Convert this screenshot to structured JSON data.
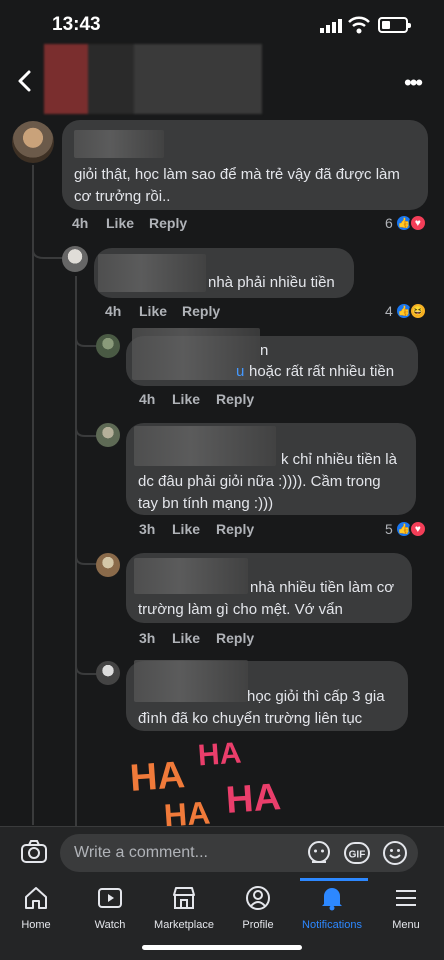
{
  "status_bar": {
    "time": "13:43"
  },
  "header": {
    "more_label": "•••"
  },
  "comments": [
    {
      "text": "giỏi thật, học làm sao để mà trẻ vậy đã được làm cơ trưởng rồi..",
      "time": "4h",
      "like": "Like",
      "reply": "Reply",
      "reaction_count": "6",
      "reactions": [
        "like",
        "love"
      ]
    },
    {
      "text": "nhà phải nhiều tiền",
      "time": "4h",
      "like": "Like",
      "reply": "Reply",
      "reaction_count": "4",
      "reactions": [
        "like",
        "haha"
      ]
    },
    {
      "text": "n",
      "text2": "u",
      "text3": "hoặc rất rất nhiều tiền",
      "time": "4h",
      "like": "Like",
      "reply": "Reply"
    },
    {
      "text": "k chỉ nhiều tiền là",
      "text2": "dc đâu phải giỏi nữa :)))). Cầm trong",
      "text3": "tay bn tính mạng :)))",
      "time": "3h",
      "like": "Like",
      "reply": "Reply",
      "reaction_count": "5",
      "reactions": [
        "like",
        "love"
      ]
    },
    {
      "text": "nhà nhiều tiền làm cơ",
      "text2": "trường làm gì cho mệt. Vớ vẩn",
      "time": "3h",
      "like": "Like",
      "reply": "Reply"
    },
    {
      "text": "học giỏi thì cấp 3 gia",
      "text2": "đình đã ko chuyển trường liên tục"
    }
  ],
  "sticker": {
    "w1": "HA",
    "w2": "HA",
    "w3": "HA",
    "w4": "HA"
  },
  "composer": {
    "placeholder": "Write a comment..."
  },
  "tabs": [
    {
      "label": "Home"
    },
    {
      "label": "Watch"
    },
    {
      "label": "Marketplace"
    },
    {
      "label": "Profile"
    },
    {
      "label": "Notifications"
    },
    {
      "label": "Menu"
    }
  ],
  "colors": {
    "accent": "#2d88ff",
    "bubble": "#3a3b3c",
    "background": "#18191a"
  }
}
